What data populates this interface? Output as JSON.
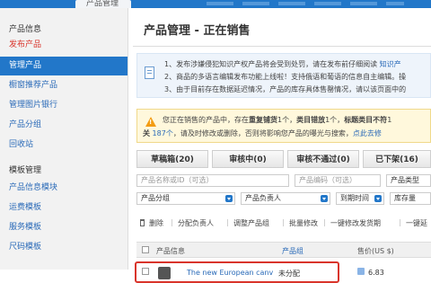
{
  "topbar": {
    "active_tab": "产品管理"
  },
  "sidebar": {
    "section_product": "产品信息",
    "items": [
      {
        "label": "发布产品"
      },
      {
        "label": "管理产品"
      },
      {
        "label": "橱窗推荐产品"
      },
      {
        "label": "管理图片银行"
      },
      {
        "label": "产品分组"
      },
      {
        "label": "回收站"
      }
    ],
    "section_template": "模板管理",
    "template_items": [
      {
        "label": "产品信息模块"
      },
      {
        "label": "运费模板"
      },
      {
        "label": "服务模板"
      },
      {
        "label": "尺码模板"
      }
    ]
  },
  "main": {
    "title": "产品管理 - 正在销售",
    "notice": {
      "line1_prefix": "1、发布涉嫌侵犯知识产权产品将会受到处罚，请在发布前仔细阅读",
      "line1_link": "知识产",
      "line2": "2、商品的多语言编辑发布功能上线啦！支持俄语和葡语的信息自主编辑。操",
      "line3": "3、由于目前存在数据延迟情况，产品的库存具体售罄情况，请以该页面中的"
    },
    "warning": {
      "line1_a": "您正在销售的产品中，存在",
      "line1_b": "重复铺货",
      "line1_c": "1个，",
      "line1_d": "类目错放",
      "line1_e": "1个，",
      "line1_f": "标题类目不符",
      "line1_g": "1",
      "line2_a": "关",
      "line2_b": "187个",
      "line2_c": "，请及时修改或删除，否则将影响您产品的曝光与搜索，",
      "line2_d": "点此去修"
    },
    "tabs": [
      {
        "label": "草稿箱(20)"
      },
      {
        "label": "审核中(0)"
      },
      {
        "label": "审核不通过(0)"
      },
      {
        "label": "已下架(16)"
      }
    ],
    "filters": {
      "product_name_placeholder": "产品名称或ID（可选）",
      "product_code_placeholder": "产品编码（可选）",
      "product_type": "产品类型",
      "product_group": "产品分组",
      "product_owner": "产品负责人",
      "expire_time": "到期时间",
      "stock_sort": "库存量"
    },
    "actions": {
      "delete": "删除",
      "assign_owner": "分配负责人",
      "adjust_group": "调整产品组",
      "batch_edit": "批量修改",
      "one_click_shipping": "一键修改发货期",
      "one_click_more": "一键延"
    },
    "table": {
      "col_info": "产品信息",
      "col_group": "产品组",
      "col_price": "售价(US $)",
      "rows": [
        {
          "name": "The new European canv",
          "group": "未分配",
          "price": "6.83"
        }
      ]
    }
  }
}
